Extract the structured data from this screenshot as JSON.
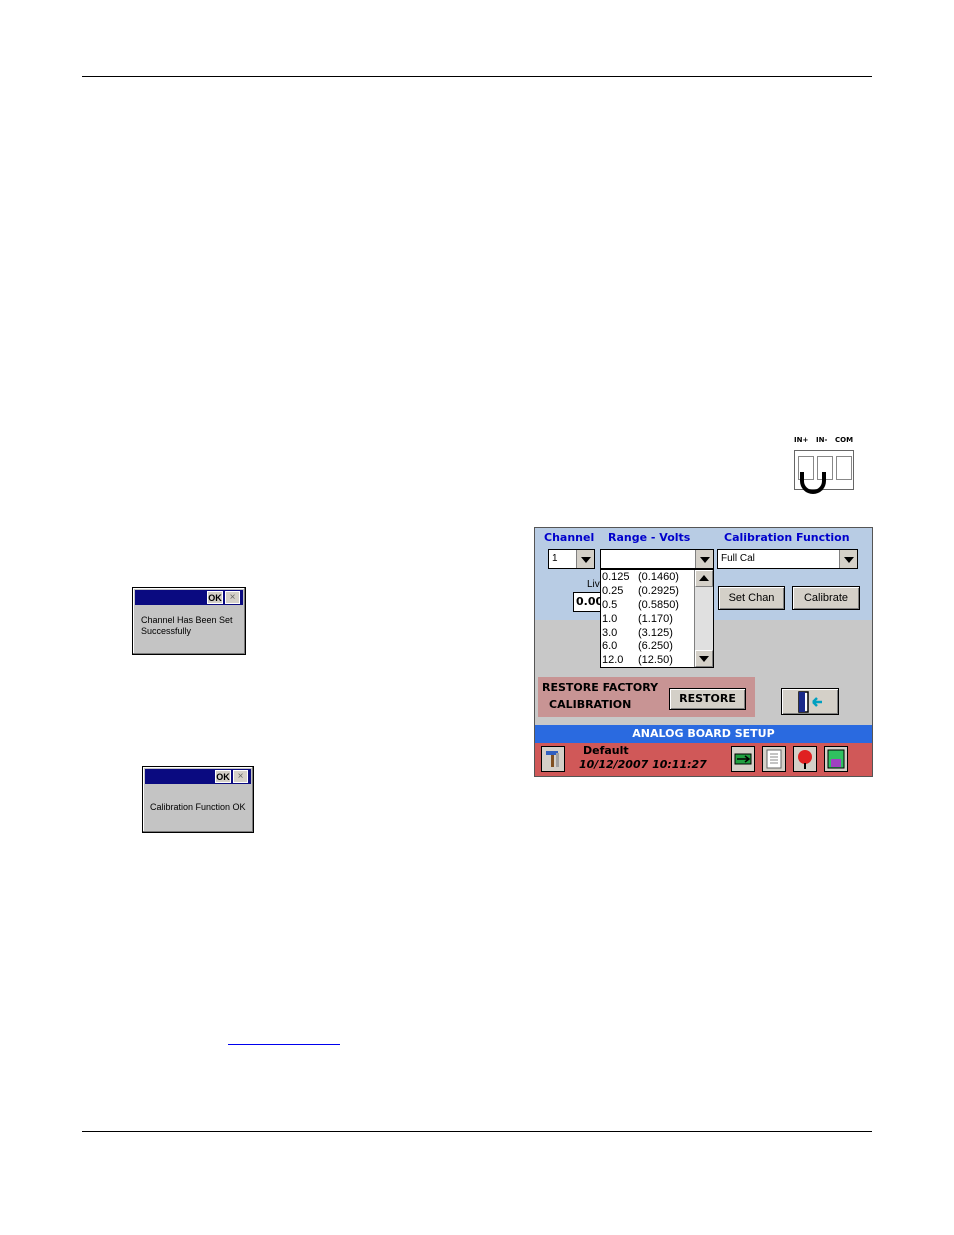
{
  "terminal": {
    "labels": [
      "IN+",
      "IN-",
      "COM"
    ]
  },
  "dialogs": {
    "channel": {
      "ok": "OK",
      "close": "×",
      "message_line1": "Channel Has Been Set",
      "message_line2": "Successfully"
    },
    "calibration": {
      "ok": "OK",
      "close": "×",
      "message": "Calibration Function OK"
    }
  },
  "panel": {
    "headers": {
      "channel": "Channel",
      "range": "Range - Volts",
      "calibration": "Calibration Function"
    },
    "channel_value": "1",
    "range_value": "",
    "calibration_value": "Full Cal",
    "live_label": "Liv",
    "live_value": "0.00",
    "range_options": [
      [
        "0.125",
        "(0.1460)"
      ],
      [
        "0.25",
        "(0.2925)"
      ],
      [
        "0.5",
        "(0.5850)"
      ],
      [
        "1.0",
        "(1.170)"
      ],
      [
        "3.0",
        "(3.125)"
      ],
      [
        "6.0",
        "(6.250)"
      ],
      [
        "12.0",
        "(12.50)"
      ]
    ],
    "buttons": {
      "set_chan": "Set Chan",
      "calibrate": "Calibrate",
      "restore": "RESTORE"
    },
    "restore_label_line1": "RESTORE FACTORY",
    "restore_label_line2": "CALIBRATION",
    "screen_title": "ANALOG BOARD SETUP",
    "status": {
      "profile": "Default",
      "datetime": "10/12/2007 10:11:27"
    },
    "icons": [
      "tools-icon",
      "transfer-icon",
      "report-icon",
      "alarm-icon",
      "save-icon"
    ]
  }
}
